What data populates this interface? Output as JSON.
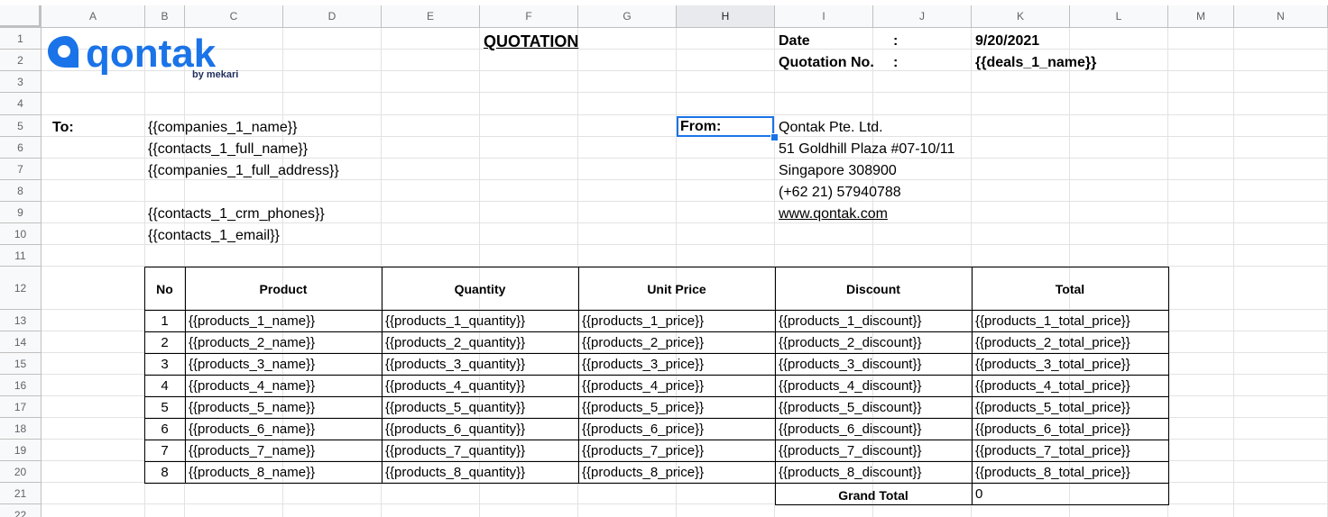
{
  "columns": [
    "A",
    "B",
    "C",
    "D",
    "E",
    "F",
    "G",
    "H",
    "I",
    "J",
    "K",
    "L",
    "M",
    "N"
  ],
  "selected_column": "H",
  "rows": [
    "1",
    "2",
    "3",
    "4",
    "5",
    "6",
    "7",
    "8",
    "9",
    "10",
    "11",
    "12",
    "13",
    "14",
    "15",
    "16",
    "17",
    "18",
    "19",
    "20",
    "21",
    "22"
  ],
  "logo": {
    "brand": "qontak",
    "tagline": "by mekari",
    "color": "#1a73e8"
  },
  "header": {
    "title": "QUOTATION",
    "date_label": "Date",
    "date_colon": ":",
    "date_value": "9/20/2021",
    "quote_label": "Quotation No.",
    "quote_colon": ":",
    "quote_value": "{{deals_1_name}}"
  },
  "to": {
    "label": "To:",
    "lines": [
      "{{companies_1_name}}",
      "{{contacts_1_full_name}}",
      "{{companies_1_full_address}}",
      "",
      "{{contacts_1_crm_phones}}",
      "{{contacts_1_email}}"
    ]
  },
  "from": {
    "label": "From:",
    "company": "Qontak Pte. Ltd.",
    "address1": "51 Goldhill Plaza #07-10/11",
    "address2": "Singapore 308900",
    "phone": "(+62 21) 57940788",
    "website": "www.qontak.com"
  },
  "table": {
    "headers": [
      "No",
      "Product",
      "Quantity",
      "Unit Price",
      "Discount",
      "Total"
    ],
    "rows": [
      [
        "1",
        "{{products_1_name}}",
        "{{products_1_quantity}}",
        "{{products_1_price}}",
        "{{products_1_discount}}",
        "{{products_1_total_price}}"
      ],
      [
        "2",
        "{{products_2_name}}",
        "{{products_2_quantity}}",
        "{{products_2_price}}",
        "{{products_2_discount}}",
        "{{products_2_total_price}}"
      ],
      [
        "3",
        "{{products_3_name}}",
        "{{products_3_quantity}}",
        "{{products_3_price}}",
        "{{products_3_discount}}",
        "{{products_3_total_price}}"
      ],
      [
        "4",
        "{{products_4_name}}",
        "{{products_4_quantity}}",
        "{{products_4_price}}",
        "{{products_4_discount}}",
        "{{products_4_total_price}}"
      ],
      [
        "5",
        "{{products_5_name}}",
        "{{products_5_quantity}}",
        "{{products_5_price}}",
        "{{products_5_discount}}",
        "{{products_5_total_price}}"
      ],
      [
        "6",
        "{{products_6_name}}",
        "{{products_6_quantity}}",
        "{{products_6_price}}",
        "{{products_6_discount}}",
        "{{products_6_total_price}}"
      ],
      [
        "7",
        "{{products_7_name}}",
        "{{products_7_quantity}}",
        "{{products_7_price}}",
        "{{products_7_discount}}",
        "{{products_7_total_price}}"
      ],
      [
        "8",
        "{{products_8_name}}",
        "{{products_8_quantity}}",
        "{{products_8_price}}",
        "{{products_8_discount}}",
        "{{products_8_total_price}}"
      ]
    ],
    "grand_total_label": "Grand Total",
    "grand_total_value": "0"
  }
}
